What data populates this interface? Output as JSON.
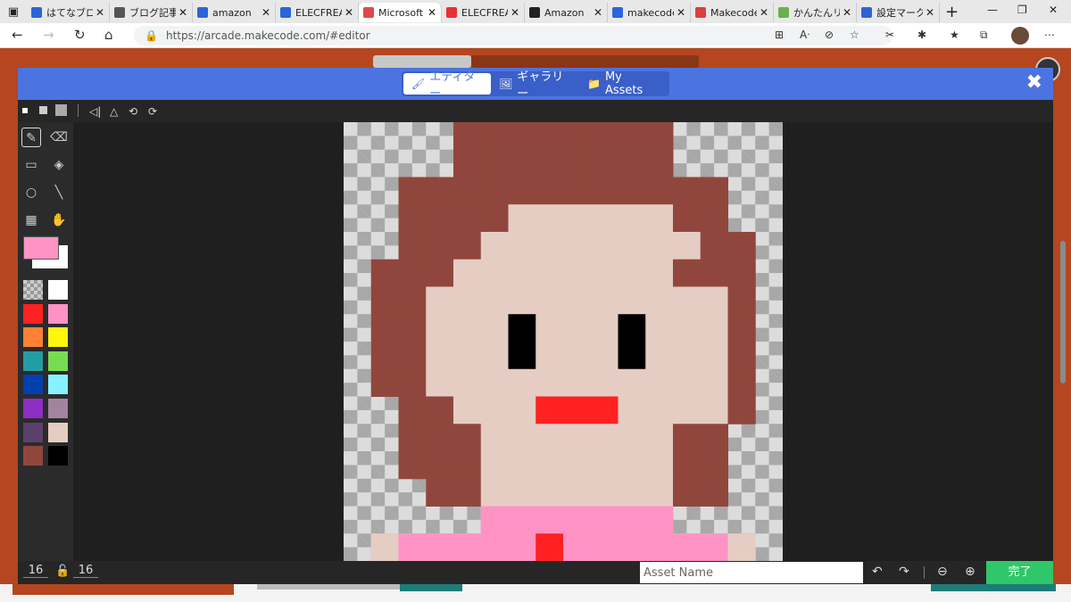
{
  "browser": {
    "tabs": [
      {
        "title": "はてなブロ",
        "icon": "search-icon",
        "fav_color": "#2b65d9"
      },
      {
        "title": "ブログ記事",
        "icon": "info-icon",
        "fav_color": "#555555"
      },
      {
        "title": "amazon",
        "icon": "search-icon",
        "fav_color": "#2b65d9"
      },
      {
        "title": "ELECFREA",
        "icon": "search-icon",
        "fav_color": "#2b65d9"
      },
      {
        "title": "Microsoft",
        "icon": "makecode-icon",
        "fav_color": "#e04848",
        "active": true
      },
      {
        "title": "ELECFREA",
        "icon": "elecfreaks-icon",
        "fav_color": "#e83030"
      },
      {
        "title": "Amazon",
        "icon": "amazon-icon",
        "fav_color": "#222222"
      },
      {
        "title": "makecode",
        "icon": "search-icon",
        "fav_color": "#2b65d9"
      },
      {
        "title": "Makecode",
        "icon": "makecode-k-icon",
        "fav_color": "#d94040"
      },
      {
        "title": "かんたんリ",
        "icon": "kantan-icon",
        "fav_color": "#6ab04c"
      },
      {
        "title": "設定マーク",
        "icon": "search-icon",
        "fav_color": "#2b65d9"
      }
    ],
    "new_tab": "+",
    "url": "https://arcade.makecode.com/#editor"
  },
  "editor": {
    "tabs": [
      {
        "label": "エディター",
        "icon": "paintbrush-icon",
        "glyph": "🖌",
        "active": true
      },
      {
        "label": "ギャラリー",
        "icon": "image-icon",
        "glyph": "🖼",
        "active": false
      },
      {
        "label": "My Assets",
        "icon": "folder-icon",
        "glyph": "📁",
        "active": false
      }
    ],
    "close_glyph": "✖",
    "canvas_width": "16",
    "canvas_height": "16",
    "asset_name_placeholder": "Asset Name",
    "done_label": "完了",
    "primary_color": "#ff93c4",
    "secondary_color": "#ffffff",
    "palette": [
      "transparent",
      "#ffffff",
      "#ff2121",
      "#ff93c4",
      "#ff8135",
      "#fff609",
      "#249ca3",
      "#78dc52",
      "#003fad",
      "#87f2ff",
      "#8e2ec4",
      "#a4839f",
      "#5c406c",
      "#e5cdc4",
      "#91463d",
      "#000000"
    ],
    "sprite_rows": [
      "....ffffffff....",
      "....ffffffff....",
      "..ffffffffffff..",
      "..ffffssssssff..",
      "..fffssssssssff.",
      ".fffssssssssfff.",
      ".ffsssssssssssf.",
      ".ffsssbsssbsssf.",
      ".ffsssbsssbsssf.",
      ".ffsssssssssssf.",
      "..ffsssrrrssssf.",
      "..fffsssssssff..",
      "..fffsssssssff..",
      "...ffsssssssff..",
      ".....ppppppp....",
      ".sppppprpppppps."
    ],
    "sprite_key": {
      "f": "#91463d",
      "s": "#e5cdc4",
      "b": "#000000",
      "r": "#ff2121",
      "p": "#ff93c4"
    }
  }
}
